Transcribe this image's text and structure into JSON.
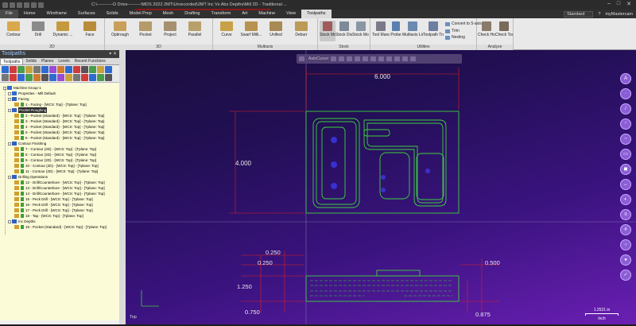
{
  "titlebar": {
    "title": "C:\\-----------D Drive---------\\MDS 2022 2MT\\Unrecorded\\2MT Inc Vs Abs Depths\\Mill 2D - Traditional ..."
  },
  "menu": {
    "tabs": [
      "File",
      "Home",
      "Wireframe",
      "Surfaces",
      "Solids",
      "Model Prep",
      "Mesh",
      "Drafting",
      "Transform",
      "Art",
      "Machine",
      "View",
      "Toolpaths"
    ],
    "active": "Toolpaths",
    "config": "Standard",
    "user": "myMastercam"
  },
  "ribbon": {
    "groups": [
      {
        "label": "2D",
        "buttons": [
          "Contour",
          "Drill",
          "Dynamic ...",
          "Face"
        ]
      },
      {
        "label": "3D",
        "buttons": [
          "Optirough",
          "Pocket",
          "Project",
          "Parallel"
        ]
      },
      {
        "label": "Multiaxis",
        "buttons": [
          "Curve",
          "Swarf Milli...",
          "Unified",
          "Deburr"
        ]
      },
      {
        "label": "Stock",
        "buttons": [
          "Stock Model",
          "Stock Display",
          "Stock Model ▾"
        ]
      },
      {
        "label": "Utilities",
        "buttons": [
          "Tool Manager",
          "Probe",
          "Multiaxis Linking",
          "Toolpath Transform"
        ],
        "small": [
          "Convert to 5-axis",
          "Trim",
          "Nesting"
        ]
      },
      {
        "label": "Analyze",
        "buttons": [
          "Check Holder",
          "Check Tool Reach"
        ]
      }
    ]
  },
  "panel": {
    "title": "Toolpaths",
    "tabs": [
      "Toolpaths",
      "Solids",
      "Planes",
      "Levels",
      "Recent Functions"
    ],
    "tree": [
      {
        "label": "Machine Group-1",
        "level": 0,
        "kind": "machine"
      },
      {
        "label": "Properties - Mill Default",
        "level": 1,
        "kind": "props"
      },
      {
        "label": "Facing",
        "level": 1,
        "kind": "group"
      },
      {
        "label": "1 - Facing - [WCS: Top] - [Tplane: Top]",
        "level": 2,
        "kind": "op"
      },
      {
        "label": "Pocket Roughing",
        "level": 1,
        "kind": "group",
        "selected": true
      },
      {
        "label": "2 - Pocket (Standard) - [WCS: Top] - [Tplane: Top]",
        "level": 2,
        "kind": "op"
      },
      {
        "label": "3 - Pocket (Standard) - [WCS: Top] - [Tplane: Top]",
        "level": 2,
        "kind": "op"
      },
      {
        "label": "4 - Pocket (Standard) - [WCS: Top] - [Tplane: Top]",
        "level": 2,
        "kind": "op"
      },
      {
        "label": "5 - Pocket (Standard) - [WCS: Top] - [Tplane: Top]",
        "level": 2,
        "kind": "op"
      },
      {
        "label": "6 - Pocket (Standard) - [WCS: Top] - [Tplane: Top]",
        "level": 2,
        "kind": "op"
      },
      {
        "label": "Contour Finishing",
        "level": 1,
        "kind": "group"
      },
      {
        "label": "7 - Contour (2D) - [WCS: Top] - [Tplane: Top]",
        "level": 2,
        "kind": "op"
      },
      {
        "label": "8 - Contour (2D) - [WCS: Top] - [Tplane: Top]",
        "level": 2,
        "kind": "op"
      },
      {
        "label": "9 - Contour (2D) - [WCS: Top] - [Tplane: Top]",
        "level": 2,
        "kind": "op"
      },
      {
        "label": "10 - Contour (2D) - [WCS: Top] - [Tplane: Top]",
        "level": 2,
        "kind": "op"
      },
      {
        "label": "11 - Contour (2D) - [WCS: Top] - [Tplane: Top]",
        "level": 2,
        "kind": "op"
      },
      {
        "label": "Drilling Operations",
        "level": 1,
        "kind": "group"
      },
      {
        "label": "12 - Drill/Counterbore - [WCS: Top] - [Tplane: Top]",
        "level": 2,
        "kind": "op"
      },
      {
        "label": "13 - Drill/Counterbore - [WCS: Top] - [Tplane: Top]",
        "level": 2,
        "kind": "op"
      },
      {
        "label": "14 - Drill/Counterbore - [WCS: Top] - [Tplane: Top]",
        "level": 2,
        "kind": "op"
      },
      {
        "label": "15 - Peck Drill - [WCS: Top] - [Tplane: Top]",
        "level": 2,
        "kind": "op"
      },
      {
        "label": "16 - Peck Drill - [WCS: Top] - [Tplane: Top]",
        "level": 2,
        "kind": "op"
      },
      {
        "label": "17 - Peck Drill - [WCS: Top] - [Tplane: Top]",
        "level": 2,
        "kind": "op"
      },
      {
        "label": "18 - Tap - [WCS: Top] - [Tplane: Top]",
        "level": 2,
        "kind": "op"
      },
      {
        "label": "Inc Depths",
        "level": 1,
        "kind": "group"
      },
      {
        "label": "19 - Pocket (Standard) - [WCS: Top] - [Tplane: Top]",
        "level": 2,
        "kind": "op"
      }
    ]
  },
  "viewport": {
    "autocursor": "AutoCursor",
    "view_name": "Top",
    "scale": "1.2531 in",
    "scale_unit": "Inch",
    "dimensions": {
      "width": "6.000",
      "height": "4.000",
      "d1": "0.250",
      "d2": "0.250",
      "d3": "1.250",
      "d4": "0.750",
      "d5": "0.500",
      "d6": "0.875"
    }
  },
  "colors": {
    "geometry": "#3dd13d",
    "dimension": "#e02020",
    "hole": "#3a2fd0",
    "viewport_top": "#1a0f3d",
    "viewport_bottom": "#6a1fb3"
  }
}
